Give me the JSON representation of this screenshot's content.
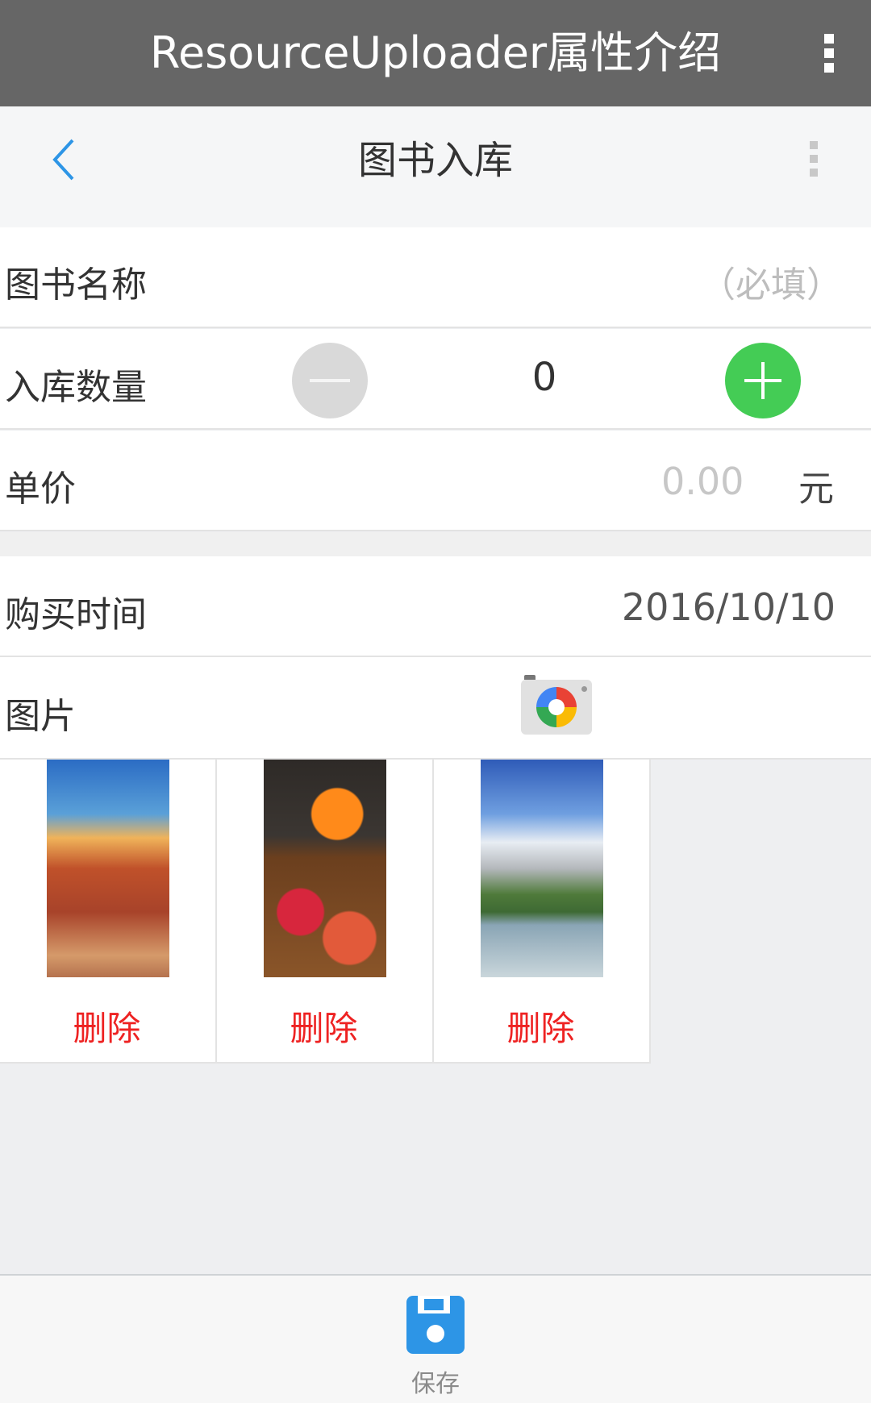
{
  "app_bar": {
    "title": "ResourceUploader属性介绍",
    "menu_icon": "more-vertical-icon"
  },
  "nav": {
    "title": "图书入库",
    "back_icon": "chevron-left-icon",
    "menu_icon": "more-vertical-icon"
  },
  "form": {
    "book_name": {
      "label": "图书名称",
      "placeholder": "（必填）"
    },
    "quantity": {
      "label": "入库数量",
      "value": "0",
      "minus_icon": "minus-icon",
      "plus_icon": "plus-icon"
    },
    "price": {
      "label": "单价",
      "placeholder": "0.00",
      "unit": "元"
    },
    "purchase_date": {
      "label": "购买时间",
      "value": "2016/10/10"
    },
    "pictures": {
      "label": "图片",
      "camera_icon": "camera-icon"
    }
  },
  "gallery": [
    {
      "delete_label": "删除"
    },
    {
      "delete_label": "删除"
    },
    {
      "delete_label": "删除"
    }
  ],
  "bottom": {
    "save_label": "保存",
    "save_icon": "floppy-disk-icon"
  },
  "colors": {
    "accent": "#2d95e6",
    "plus": "#44cc55",
    "delete": "#ee2222",
    "appbar": "#666666"
  }
}
